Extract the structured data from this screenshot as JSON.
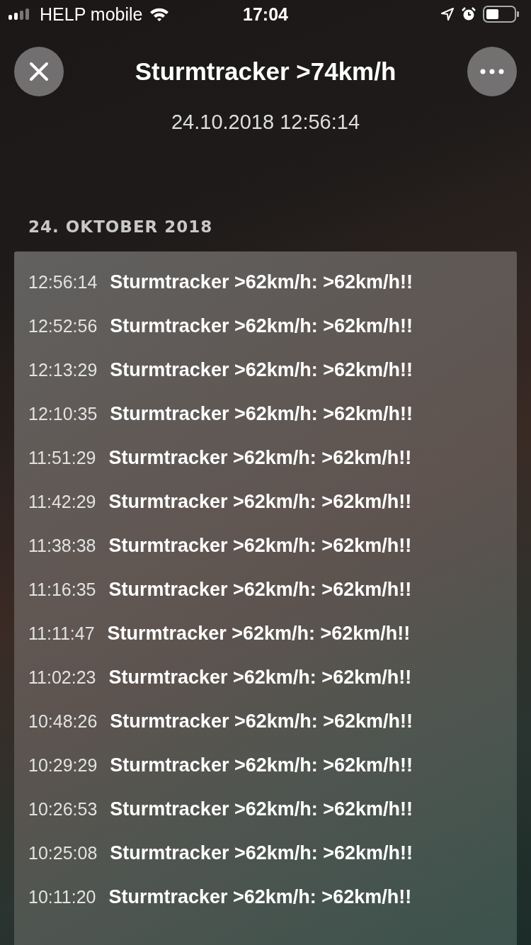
{
  "status_bar": {
    "carrier": "HELP mobile",
    "time": "17:04"
  },
  "header": {
    "title": "Sturmtracker >74km/h",
    "subtitle": "24.10.2018 12:56:14"
  },
  "section": {
    "heading": "24. OKTOBER 2018",
    "rows": [
      {
        "time": "12:56:14",
        "message": "Sturmtracker >62km/h: >62km/h!!"
      },
      {
        "time": "12:52:56",
        "message": "Sturmtracker >62km/h: >62km/h!!"
      },
      {
        "time": "12:13:29",
        "message": "Sturmtracker >62km/h: >62km/h!!"
      },
      {
        "time": "12:10:35",
        "message": "Sturmtracker >62km/h: >62km/h!!"
      },
      {
        "time": "11:51:29",
        "message": "Sturmtracker >62km/h: >62km/h!!"
      },
      {
        "time": "11:42:29",
        "message": "Sturmtracker >62km/h: >62km/h!!"
      },
      {
        "time": "11:38:38",
        "message": "Sturmtracker >62km/h: >62km/h!!"
      },
      {
        "time": "11:16:35",
        "message": "Sturmtracker >62km/h: >62km/h!!"
      },
      {
        "time": "11:11:47",
        "message": "Sturmtracker >62km/h: >62km/h!!"
      },
      {
        "time": "11:02:23",
        "message": "Sturmtracker >62km/h: >62km/h!!"
      },
      {
        "time": "10:48:26",
        "message": "Sturmtracker >62km/h: >62km/h!!"
      },
      {
        "time": "10:29:29",
        "message": "Sturmtracker >62km/h: >62km/h!!"
      },
      {
        "time": "10:26:53",
        "message": "Sturmtracker >62km/h: >62km/h!!"
      },
      {
        "time": "10:25:08",
        "message": "Sturmtracker >62km/h: >62km/h!!"
      },
      {
        "time": "10:11:20",
        "message": "Sturmtracker >62km/h: >62km/h!!"
      }
    ]
  }
}
